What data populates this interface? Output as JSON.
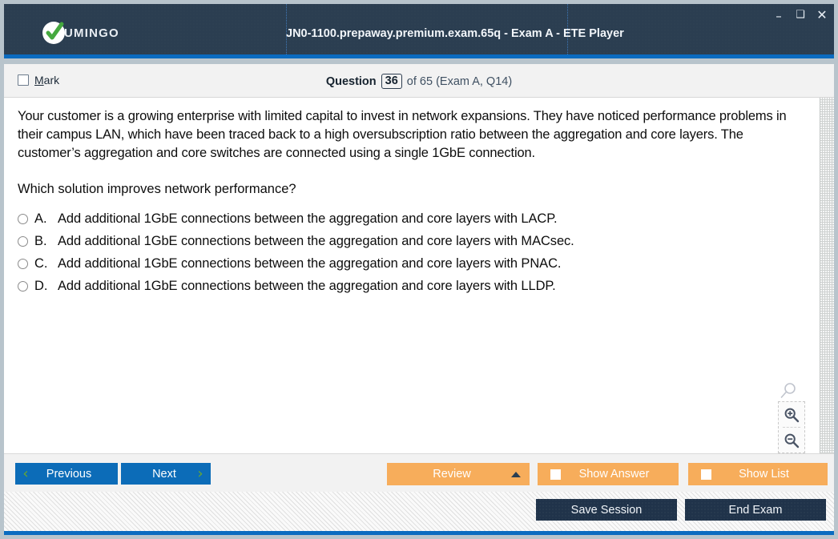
{
  "window": {
    "brand_name": "UMINGO",
    "brand_icon": "check-circle-logo",
    "title": "JN0-1100.prepaway.premium.exam.65q - Exam A - ETE Player",
    "controls": {
      "minimize": "–",
      "maximize": "❑",
      "close": "✕"
    }
  },
  "question_header": {
    "mark_label_pre": "",
    "mark_label_accel": "M",
    "mark_label_post": "ark",
    "mark_checked": false,
    "question_word": "Question",
    "question_number": "36",
    "of_text": "of 65 (Exam A, Q14)"
  },
  "question": {
    "body": "Your customer is a growing enterprise with limited capital to invest in network expansions. They have noticed performance problems in their campus LAN, which have been traced back to a high oversubscription ratio between the aggregation and core layers. The customer’s aggregation and core switches are connected using a single 1GbE connection.",
    "prompt": "Which solution improves network performance?",
    "options": [
      {
        "letter": "A.",
        "text": "Add additional 1GbE connections between the aggregation and core layers with LACP.",
        "selected": false
      },
      {
        "letter": "B.",
        "text": "Add additional 1GbE connections between the aggregation and core layers with MACsec.",
        "selected": false
      },
      {
        "letter": "C.",
        "text": "Add additional 1GbE connections between the aggregation and core layers with PNAC.",
        "selected": false
      },
      {
        "letter": "D.",
        "text": "Add additional 1GbE connections between the aggregation and core layers with LLDP.",
        "selected": false
      }
    ]
  },
  "zoom_widget": {
    "ghost_icon": "magnifier-icon",
    "zoom_in_icon": "zoom-in-icon",
    "zoom_out_icon": "zoom-out-icon"
  },
  "navbar": {
    "previous_label": "Previous",
    "previous_icon": "chevron-left-icon",
    "next_label": "Next",
    "next_icon": "chevron-right-icon",
    "review_label": "Review",
    "review_icon": "triangle-up-icon",
    "show_answer_label": "Show Answer",
    "show_answer_checked": false,
    "show_list_label": "Show List",
    "show_list_checked": false
  },
  "footer": {
    "save_session_label": "Save Session",
    "end_exam_label": "End Exam"
  },
  "colors": {
    "titlebar": "#2b3e51",
    "accent_blue": "#0b6bc0",
    "button_blue": "#0c6cb8",
    "button_orange": "#f7ad5b",
    "chevron_green": "#6aa82f",
    "dark_button": "#20334a",
    "header_gray": "#f2f2f2"
  }
}
